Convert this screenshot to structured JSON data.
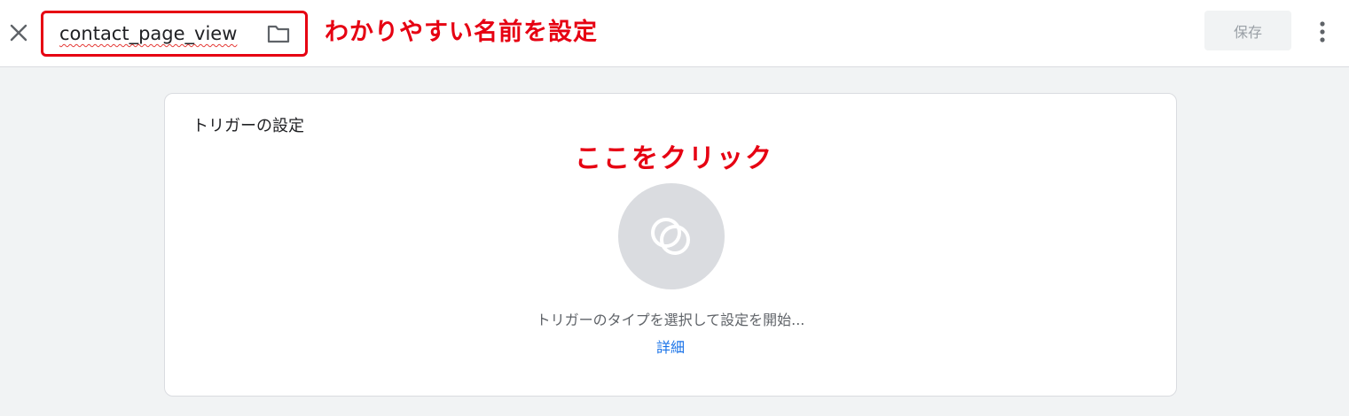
{
  "header": {
    "tag_name": "contact_page_view",
    "name_annotation": "わかりやすい名前を設定",
    "save_label": "保存"
  },
  "card": {
    "title": "トリガーの設定",
    "click_annotation": "ここをクリック",
    "prompt": "トリガーのタイプを選択して設定を開始...",
    "details_link": "詳細"
  },
  "colors": {
    "annotation_red": "#e60012",
    "link_blue": "#1a73e8"
  },
  "icons": {
    "close": "close-icon",
    "folder": "folder-icon",
    "more": "more-vert-icon",
    "trigger": "trigger-icon"
  }
}
